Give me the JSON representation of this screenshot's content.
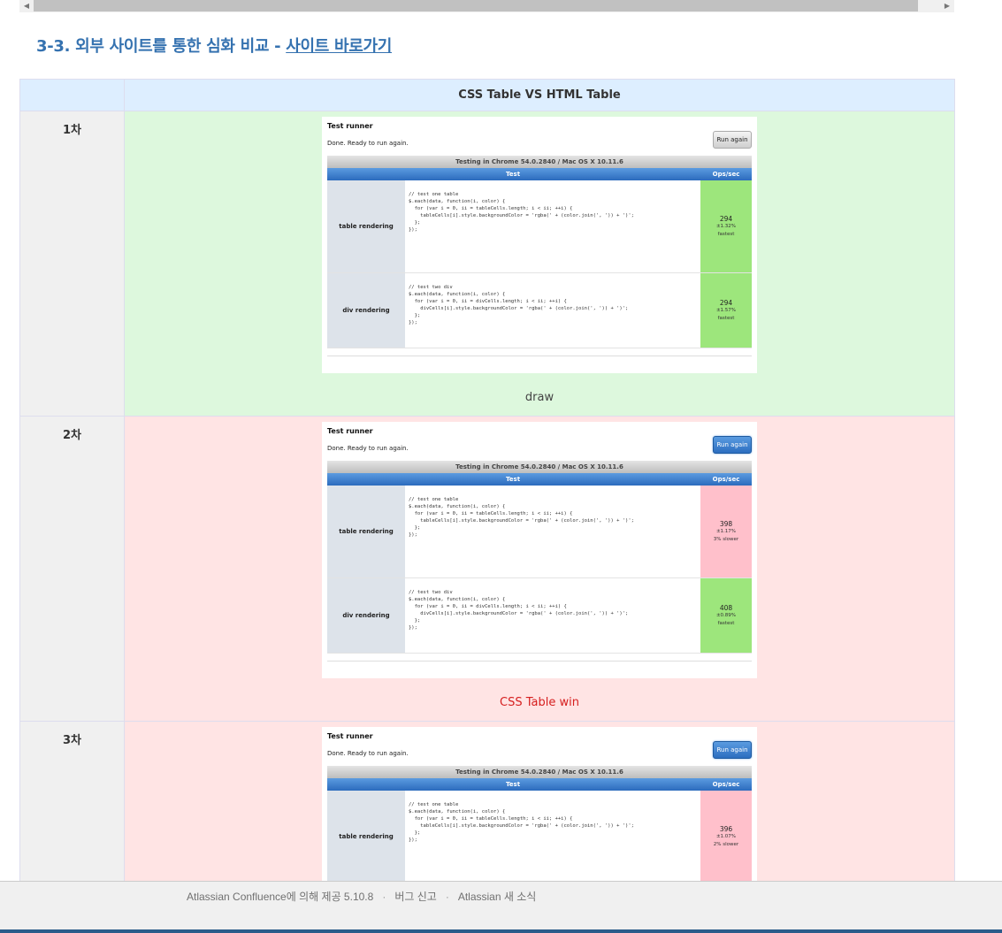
{
  "section": {
    "heading": "3-3. 외부 사이트를 통한 심화 비교 - ",
    "link_label": "사이트 바로가기"
  },
  "table": {
    "header_left": "",
    "header_right": "CSS Table  VS  HTML Table",
    "rows": [
      {
        "label": "1차",
        "verdict": "draw",
        "runner": {
          "title": "Test runner",
          "status": "Done. Ready to run again.",
          "button": "Run again",
          "environment": "Testing in Chrome 54.0.2840 / Mac OS X 10.11.6",
          "col_test": "Test",
          "col_ops": "Ops/sec",
          "tests": [
            {
              "name": "table rendering",
              "ops": "294",
              "margin": "±1.32%",
              "note": "fastest"
            },
            {
              "name": "div rendering",
              "ops": "294",
              "margin": "±1.57%",
              "note": "fastest"
            }
          ]
        }
      },
      {
        "label": "2차",
        "verdict": "CSS Table win",
        "runner": {
          "title": "Test runner",
          "status": "Done. Ready to run again.",
          "button": "Run again",
          "environment": "Testing in Chrome 54.0.2840 / Mac OS X 10.11.6",
          "col_test": "Test",
          "col_ops": "Ops/sec",
          "tests": [
            {
              "name": "table rendering",
              "ops": "398",
              "margin": "±1.17%",
              "note": "3% slower"
            },
            {
              "name": "div rendering",
              "ops": "408",
              "margin": "±0.89%",
              "note": "fastest"
            }
          ]
        }
      },
      {
        "label": "3차",
        "verdict": "",
        "runner": {
          "title": "Test runner",
          "status": "Done. Ready to run again.",
          "button": "Run again",
          "environment": "Testing in Chrome 54.0.2840 / Mac OS X 10.11.6",
          "col_test": "Test",
          "col_ops": "Ops/sec",
          "tests": [
            {
              "name": "table rendering",
              "ops": "396",
              "margin": "±1.07%",
              "note": "2% slower"
            }
          ]
        }
      }
    ],
    "code_table": "// test one table\n$.each(data, function(i, color) {\n  for (var i = 0, ii = tableCells.length; i < ii; ++i) {\n    tableCells[i].style.backgroundColor = 'rgba(' + (color.join(', ')) + ')';\n  };\n});",
    "code_div": "// test two div\n$.each(data, function(i, color) {\n  for (var i = 0, ii = divCells.length; i < ii; ++i) {\n    divCells[i].style.backgroundColor = 'rgba(' + (color.join(', ')) + ')';\n  };\n});"
  },
  "footer": {
    "powered": "Atlassian Confluence에 의해 제공 5.10.8",
    "separator": "·",
    "report_bug": "버그 신고",
    "news": "Atlassian 새 소식"
  },
  "colors": {
    "heading": "#3572b0",
    "header_bg": "#ddeeff",
    "draw_bg": "#ddf8dd",
    "win_bg": "#ffe4e4",
    "fast": "#9de67c",
    "slow": "#ffc0cb",
    "verdict_win": "#d61f1f"
  }
}
